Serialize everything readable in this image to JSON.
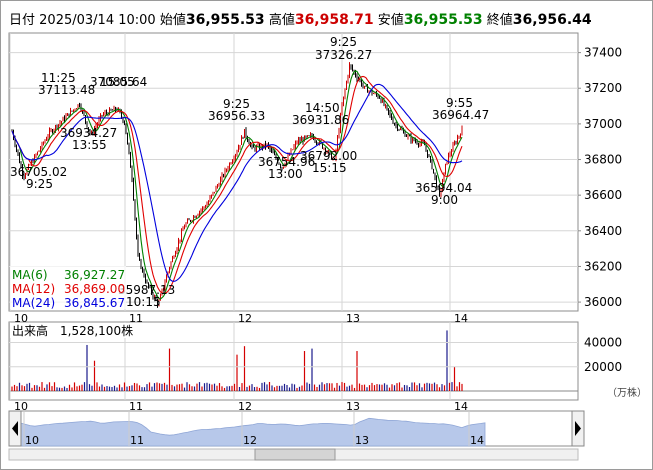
{
  "header": {
    "label": "日付",
    "datetime": "2025/03/14 10:00",
    "open_label": "始値",
    "open": "36,955.53",
    "high_label": "高値",
    "high": "36,958.71",
    "low_label": "安値",
    "low": "36,955.53",
    "close_label": "終値",
    "close": "36,956.44"
  },
  "colors": {
    "up": "#cc0000",
    "down": "#000000",
    "ma6": "#008000",
    "ma12": "#e00000",
    "ma24": "#0000dd",
    "volume_up": "#d40000",
    "volume_down": "#1a1a8c",
    "nav_fill": "#b7c8ea"
  },
  "chart_data": {
    "type": "candlestick",
    "x_tick_labels": [
      "10",
      "11",
      "12",
      "13",
      "14"
    ],
    "price_axis": {
      "ticks": [
        "37400",
        "37200",
        "37000",
        "36800",
        "36600",
        "36400",
        "36200",
        "36000"
      ],
      "ylim": [
        35950,
        37510
      ]
    },
    "price_path": [
      [
        0,
        36960
      ],
      [
        1.5,
        36705
      ],
      [
        5,
        36950
      ],
      [
        9,
        37113.48
      ],
      [
        10.5,
        36934.27
      ],
      [
        12,
        37050
      ],
      [
        14,
        37085.64
      ],
      [
        15,
        37010
      ],
      [
        16,
        36700
      ],
      [
        16.8,
        36250
      ],
      [
        18,
        36100
      ],
      [
        19.5,
        35987.13
      ],
      [
        21,
        36200
      ],
      [
        23,
        36430
      ],
      [
        26,
        36550
      ],
      [
        28,
        36700
      ],
      [
        30,
        36850
      ],
      [
        31,
        36956.33
      ],
      [
        32,
        36860
      ],
      [
        34,
        36880
      ],
      [
        36,
        36754.96
      ],
      [
        38,
        36900
      ],
      [
        40,
        36931.86
      ],
      [
        42,
        36850
      ],
      [
        43,
        36792.0
      ],
      [
        44,
        37100
      ],
      [
        45,
        37326.27
      ],
      [
        47,
        37200
      ],
      [
        49,
        37150
      ],
      [
        51,
        37000
      ],
      [
        53,
        36920
      ],
      [
        55,
        36880
      ],
      [
        56,
        36760
      ],
      [
        57,
        36594.04
      ],
      [
        58,
        36800
      ],
      [
        59.5,
        36930
      ],
      [
        60,
        36964.47
      ]
    ],
    "annotations": [
      {
        "time": "9:25",
        "value": "36705.02",
        "text": "36705.02"
      },
      {
        "time": "11:25",
        "value": "37113.48",
        "text": "37113.48"
      },
      {
        "time": "13:55",
        "value": "36934.27",
        "text": "36934.27"
      },
      {
        "time": "15:05",
        "value": "37085.64",
        "text": "37085.64"
      },
      {
        "time": "10:15",
        "value": "35987.13",
        "text": "35987.13"
      },
      {
        "time": "9:25",
        "value": "36956.33",
        "text": "36956.33"
      },
      {
        "time": "13:00",
        "value": "36754.96",
        "text": "36754.96"
      },
      {
        "time": "14:50",
        "value": "36931.86",
        "text": "36931.86"
      },
      {
        "time": "15:15",
        "value": "36792.00",
        "text": "36792.00"
      },
      {
        "time": "9:25",
        "value": "37326.27",
        "text": "37326.27"
      },
      {
        "time": "9:00",
        "value": "36594.04",
        "text": "36594.04"
      },
      {
        "time": "9:55",
        "value": "36964.47",
        "text": "36964.47"
      }
    ],
    "legend": [
      {
        "name": "MA(6)",
        "value": "36,927.27"
      },
      {
        "name": "MA(12)",
        "value": "36,869.00"
      },
      {
        "name": "MA(24)",
        "value": "36,845.67"
      }
    ],
    "volume": {
      "label": "出来高",
      "value": "1,528,100株",
      "ticks": [
        "40000",
        "20000"
      ],
      "unit": "（万株）",
      "ylim": [
        0,
        52000
      ],
      "spikes": [
        [
          10,
          38000
        ],
        [
          11,
          25000
        ],
        [
          21,
          35000
        ],
        [
          30,
          30000
        ],
        [
          31,
          37000
        ],
        [
          39,
          33000
        ],
        [
          40,
          35000
        ],
        [
          46,
          33000
        ],
        [
          58,
          50000
        ],
        [
          59,
          20000
        ]
      ]
    },
    "navigator": {
      "labels": [
        "10",
        "11",
        "12",
        "13",
        "14"
      ]
    }
  }
}
